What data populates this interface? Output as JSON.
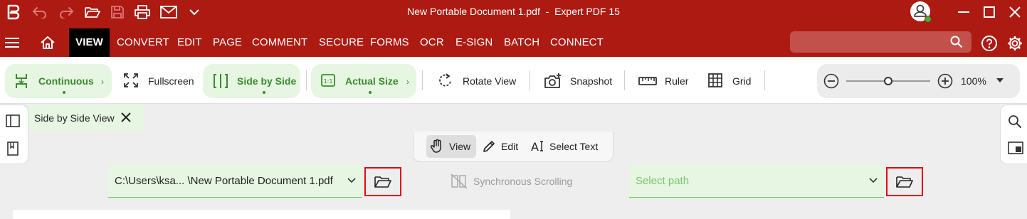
{
  "window": {
    "title": "New Portable Document 1.pdf  -  Expert PDF 15"
  },
  "menu": {
    "tabs": [
      "VIEW",
      "CONVERT",
      "EDIT",
      "PAGE",
      "COMMENT",
      "SECURE",
      "FORMS",
      "OCR",
      "E-SIGN",
      "BATCH",
      "CONNECT"
    ],
    "active": "VIEW",
    "search_placeholder": ""
  },
  "ribbon": {
    "continuous": "Continuous",
    "fullscreen": "Fullscreen",
    "side_by_side": "Side by Side",
    "actual_size": "Actual Size",
    "rotate_view": "Rotate View",
    "snapshot": "Snapshot",
    "ruler": "Ruler",
    "grid": "Grid",
    "zoom_level": "100%",
    "zoom_fraction": 0.5
  },
  "tab_strip": {
    "title": "Side by Side View"
  },
  "viewbar": {
    "view": "View",
    "edit": "Edit",
    "select_text": "Select Text"
  },
  "compare": {
    "left_path": "C:\\Users\\ksa... \\New Portable Document 1.pdf",
    "sync_label": "Synchronous Scrolling",
    "right_placeholder": "Select path"
  },
  "colors": {
    "titlebar": "#ac1a12",
    "accent_green": "#3a8c2c",
    "pill_bg": "#e6f6e2",
    "highlight_red": "#e0090f"
  }
}
